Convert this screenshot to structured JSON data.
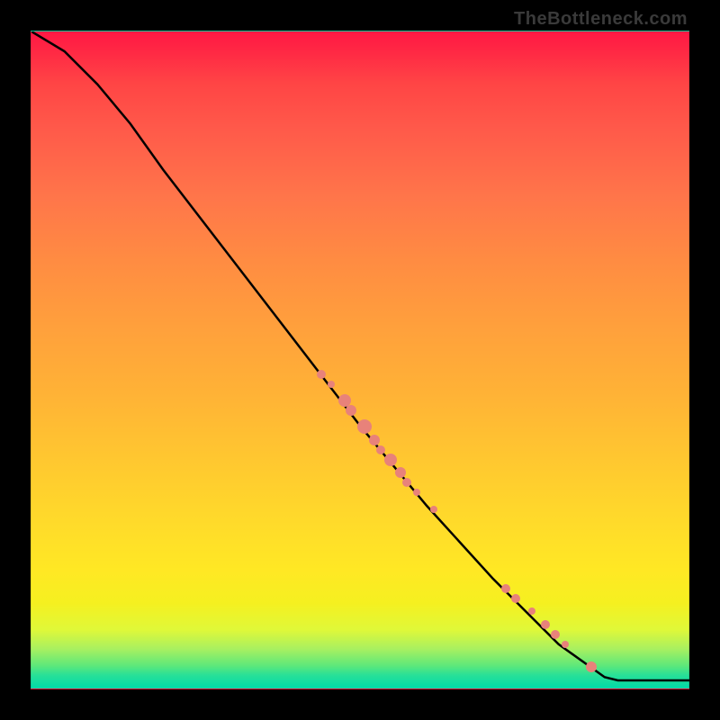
{
  "watermark": "TheBottleneck.com",
  "chart_data": {
    "type": "line",
    "title": "",
    "xlabel": "",
    "ylabel": "",
    "xlim": [
      0,
      100
    ],
    "ylim": [
      0,
      100
    ],
    "background_gradient": "rainbow_red_to_green",
    "curve": [
      {
        "x": 0,
        "y": 100
      },
      {
        "x": 5,
        "y": 97
      },
      {
        "x": 10,
        "y": 92
      },
      {
        "x": 15,
        "y": 86
      },
      {
        "x": 20,
        "y": 79
      },
      {
        "x": 30,
        "y": 66
      },
      {
        "x": 40,
        "y": 53
      },
      {
        "x": 50,
        "y": 40
      },
      {
        "x": 60,
        "y": 28
      },
      {
        "x": 70,
        "y": 17
      },
      {
        "x": 80,
        "y": 7
      },
      {
        "x": 87,
        "y": 2
      },
      {
        "x": 89,
        "y": 1.5
      },
      {
        "x": 100,
        "y": 1.5
      }
    ],
    "series": [
      {
        "name": "highlighted_points",
        "marker": "circle",
        "color": "#e8827a",
        "points": [
          {
            "x": 44,
            "y": 48,
            "size": 10
          },
          {
            "x": 45.5,
            "y": 46.5,
            "size": 8
          },
          {
            "x": 47.5,
            "y": 44,
            "size": 14
          },
          {
            "x": 48.5,
            "y": 42.5,
            "size": 12
          },
          {
            "x": 50.5,
            "y": 40,
            "size": 16
          },
          {
            "x": 52,
            "y": 38,
            "size": 12
          },
          {
            "x": 53,
            "y": 36.5,
            "size": 10
          },
          {
            "x": 54.5,
            "y": 35,
            "size": 14
          },
          {
            "x": 56,
            "y": 33,
            "size": 12
          },
          {
            "x": 57,
            "y": 31.5,
            "size": 10
          },
          {
            "x": 58.5,
            "y": 30,
            "size": 8
          },
          {
            "x": 61,
            "y": 27.5,
            "size": 8
          },
          {
            "x": 72,
            "y": 15.5,
            "size": 10
          },
          {
            "x": 73.5,
            "y": 14,
            "size": 10
          },
          {
            "x": 76,
            "y": 12,
            "size": 8
          },
          {
            "x": 78,
            "y": 10,
            "size": 10
          },
          {
            "x": 79.5,
            "y": 8.5,
            "size": 10
          },
          {
            "x": 81,
            "y": 7,
            "size": 8
          },
          {
            "x": 85,
            "y": 3.5,
            "size": 12
          }
        ]
      }
    ]
  }
}
